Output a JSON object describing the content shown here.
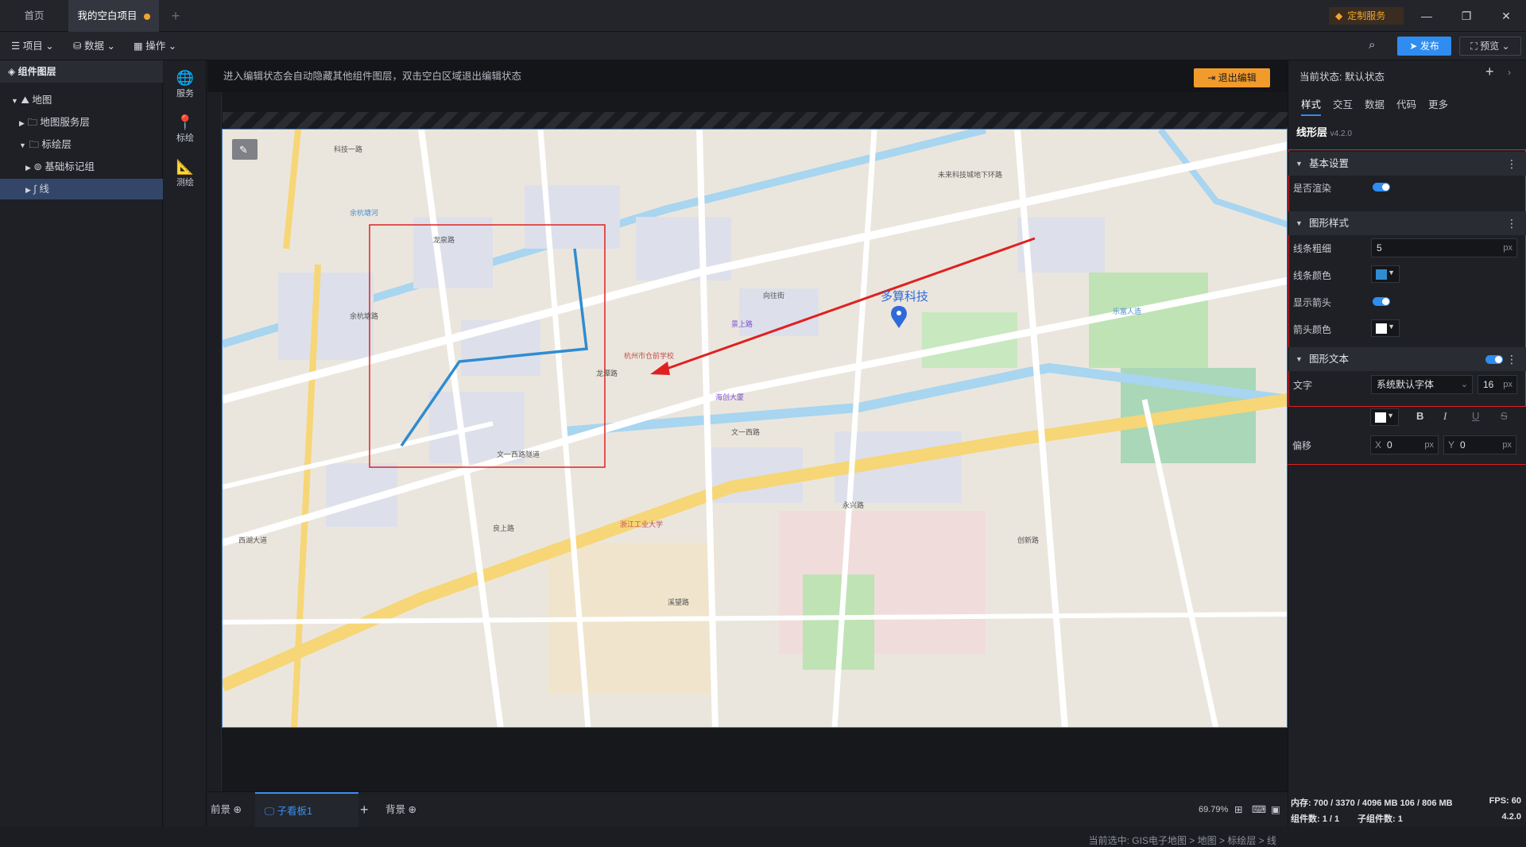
{
  "tabs": [
    {
      "label": "首页"
    },
    {
      "label": "我的空白项目"
    }
  ],
  "top_right": {
    "custom_service": "定制服务"
  },
  "toolbar": {
    "menus": [
      "项目",
      "数据",
      "操作"
    ],
    "publish": "发布",
    "preview": "预览"
  },
  "left_panel": {
    "title": "组件图层",
    "tree": [
      {
        "label": "地图"
      },
      {
        "label": "地图服务层"
      },
      {
        "label": "标绘层"
      },
      {
        "label": "基础标记组"
      },
      {
        "label": "线"
      }
    ]
  },
  "strip": [
    {
      "label": "服务",
      "icon": "globe-icon"
    },
    {
      "label": "标绘",
      "icon": "pin-icon"
    },
    {
      "label": "测绘",
      "icon": "ruler-icon"
    }
  ],
  "canvas": {
    "notice": "进入编辑状态会自动隐藏其他组件图层，双击空白区域退出编辑状态",
    "exit_button": "退出编辑",
    "breadcrumb": "当前选中: GIS电子地图 > 地图 > 标绘层 > 线"
  },
  "map": {
    "marker_label": "多算科技",
    "road_labels": [
      "科技一路",
      "龙泉路",
      "余杭塘路",
      "余杭塘河",
      "未来科技城地下环路",
      "龙潭路",
      "文一西路",
      "文一西路隧道",
      "向往街",
      "创新路",
      "溪望路",
      "永兴路",
      "浙江工业大学",
      "杭州市仓前学校",
      "景上路",
      "良上路",
      "海创大厦",
      "乐富人造",
      "西湖大道"
    ]
  },
  "bottom": {
    "front": "前景",
    "sub_board": "子看板1",
    "add": "+",
    "back": "背景",
    "zoom": "69.79%"
  },
  "right_panel": {
    "state_label": "当前状态:",
    "state_value": "默认状态",
    "tabs": [
      "样式",
      "交互",
      "数据",
      "代码",
      "更多"
    ],
    "layer_name": "线形层",
    "version": "v4.2.0",
    "sections": {
      "basic": "基本设置",
      "shape_style": "图形样式",
      "shape_text": "图形文本"
    },
    "props": {
      "render": "是否渲染",
      "line_width": "线条粗细",
      "line_width_value": "5",
      "line_color": "线条颜色",
      "show_arrow": "显示箭头",
      "arrow_color": "箭头颜色",
      "text": "文字",
      "font": "系统默认字体",
      "font_size": "16",
      "offset": "偏移",
      "offset_x_label": "X",
      "offset_x": "0",
      "offset_y_label": "Y",
      "offset_y": "0",
      "unit": "px"
    },
    "colors": {
      "line": "#2f8cd0",
      "arrow": "#ffffff",
      "text": "#ffffff"
    }
  },
  "status": {
    "memory": "内存: 700 / 3370 / 4096 MB  106 / 806 MB",
    "fps": "FPS: 60",
    "components": "组件数: 1 / 1",
    "sub_components": "子组件数: 1",
    "version": "4.2.0"
  }
}
